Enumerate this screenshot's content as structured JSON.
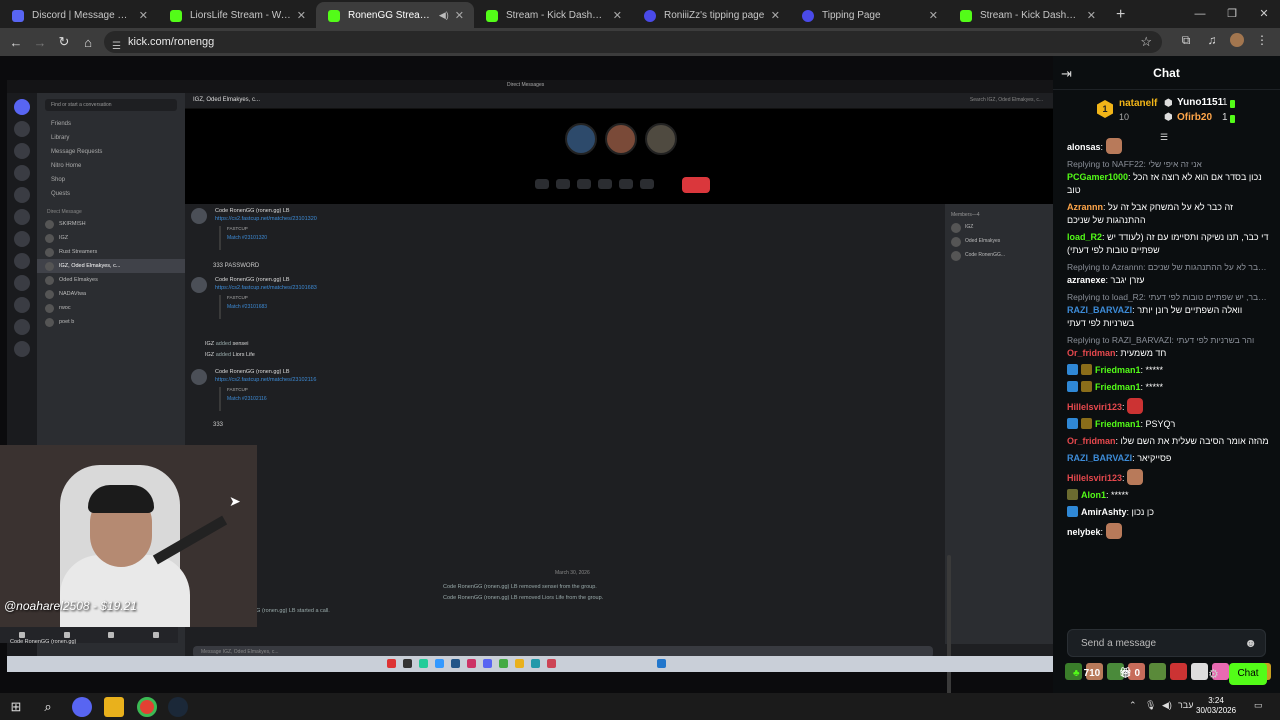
{
  "browser": {
    "tabs": [
      {
        "label": "Discord | Message Requests",
        "color": "#5865f2"
      },
      {
        "label": "LiorsLife Stream - Watch Live o",
        "color": "#53fc18"
      },
      {
        "label": "RonenGG Stream - Watch L",
        "color": "#53fc18"
      },
      {
        "label": "Stream - Kick Dashboard",
        "color": "#53fc18"
      },
      {
        "label": "RoniiiZz's tipping page",
        "color": "#4a4ae8"
      },
      {
        "label": "Tipping Page",
        "color": "#4a4ae8"
      },
      {
        "label": "Stream - Kick Dashboard",
        "color": "#53fc18"
      }
    ],
    "url": "kick.com/ronengg"
  },
  "discord": {
    "window_title": "Direct Messages",
    "find_placeholder": "Find or start a conversation",
    "nav": [
      "Friends",
      "Library",
      "Message Requests",
      "Nitro Home",
      "Shop",
      "Quests"
    ],
    "dm_header": "Direct Message",
    "dms": [
      "SKIRMISH",
      "IGZ",
      "Rust Streamers",
      "IGZ, Oded Elmakyes, c...",
      "Oded Elmakyes",
      "NADAVtwa",
      "rwoc",
      "poet b"
    ],
    "channel_header": "IGZ, Oded Elmakyes, c...",
    "search_placeholder": "Search IGZ, Oded Elmakyes, c...",
    "messages": [
      {
        "name": "Code RonenGG (ronen.gg) LB",
        "link": "https://cs2.fastcup.net/matches/23101320",
        "embed_title": "FASTCUP",
        "embed_link": "Match #23101320"
      },
      {
        "name": "Code RonenGG (ronen.gg) LB",
        "link": "https://cs2.fastcup.net/matches/23101683",
        "embed_title": "FASTCUP",
        "embed_link": "Match #23101683"
      },
      {
        "name": "Code RonenGG (ronen.gg) LB",
        "link": "https://cs2.fastcup.net/matches/23102116",
        "embed_title": "FASTCUP",
        "embed_link": "Match #23102116"
      }
    ],
    "text_password": "333 PASSWORD",
    "text_333": "333",
    "system_1_user": "IGZ",
    "system_1_text": "added",
    "system_1_target": "sensei",
    "system_2_user": "IGZ",
    "system_2_text": "added",
    "system_2_target": "Liors Life",
    "date_divider": "March 30, 2026",
    "removed_1": "Code RonenGG (ronen.gg) LB removed sensei from the group.",
    "removed_2": "Code RonenGG (ronen.gg) LB removed Liors Life from the group.",
    "started_call": "Code RonenGG (ronen.gg) LB started a call.",
    "input_placeholder": "Message IGZ, Oded Elmakyes, c...",
    "members_header": "Members—4",
    "members": [
      "IGZ",
      "Oded Elmakyes",
      "Code RonenGG..."
    ],
    "self_name": "Code RonenGG (ronen.gg)"
  },
  "overlay": {
    "tip_text": "@noaharel2508 - $19.21"
  },
  "chat": {
    "title": "Chat",
    "top_gifters": [
      {
        "name": "natanelf",
        "count": "10",
        "color": "#f2b518"
      },
      {
        "name": "Yuno1151",
        "count": "1",
        "color": "#ffffff"
      },
      {
        "name": "Ofirb20",
        "count": "1",
        "color": "#ffa64a"
      }
    ],
    "gift_rank": "1",
    "messages": [
      {
        "user": "alonsas",
        "color": "#ffffff",
        "reply": "",
        "text": ""
      },
      {
        "user": "PCGamer1000",
        "color": "#53fc18",
        "reply": "Replying to NAFF22: אני זה איפי שלי",
        "text": "נכון בסדר אם הוא לא רוצה אז הכל טוב"
      },
      {
        "user": "Azrannn",
        "color": "#ffa64a",
        "reply": "",
        "text": "זה כבר לא על המשחק אבל זה על ההתנהגות של שניכם"
      },
      {
        "user": "load_R2",
        "color": "#53fc18",
        "reply": "",
        "text": "די כבר, תנו נשיקה ותסיימו עם זה (לעודד יש שפתיים טובות לפי דעתי)"
      },
      {
        "user": "azranexe",
        "color": "#ffffff",
        "reply": "Replying to Azrannn: זה כבר לא על ההתנהגות של שניכם",
        "text": "עזרן יגבר"
      },
      {
        "user": "RAZI_BARVAZI",
        "color": "#3d8cd8",
        "reply": "Replying to load_R2: די כבר, יש שפתיים טובות לפי דעתי",
        "text": "וואלה השפתיים של רונן יותר בשרניות לפי דעתי"
      },
      {
        "user": "Or_fridman",
        "color": "#e5484d",
        "reply": "Replying to RAZI_BARVAZI: והר בשרניות לפי דעתי",
        "text": "חד משמעית"
      },
      {
        "user": "Friedman1",
        "color": "#53fc18",
        "reply": "",
        "text": "*****"
      },
      {
        "user": "Friedman1",
        "color": "#53fc18",
        "reply": "",
        "text": "*****"
      },
      {
        "user": "Hillelsviri123",
        "color": "#e5484d",
        "reply": "",
        "text": ""
      },
      {
        "user": "Friedman1",
        "color": "#53fc18",
        "reply": "",
        "text": "PSYQר"
      },
      {
        "user": "Or_fridman",
        "color": "#e5484d",
        "reply": "",
        "text": "מהזה אומר הסיבה שעלית את השם שלו"
      },
      {
        "user": "RAZI_BARVAZI",
        "color": "#3d8cd8",
        "reply": "",
        "text": "פסייקיאר"
      },
      {
        "user": "Hillelsviri123",
        "color": "#e5484d",
        "reply": "",
        "text": ""
      },
      {
        "user": "Alon1",
        "color": "#53fc18",
        "reply": "",
        "text": "*****"
      },
      {
        "user": "AmirAshty",
        "color": "#ffffff",
        "reply": "",
        "text": "כן נכון"
      },
      {
        "user": "nelybek",
        "color": "#ffffff",
        "reply": "",
        "text": ""
      }
    ],
    "send_placeholder": "Send a message",
    "points": "710",
    "gifts": "0",
    "chat_button": "Chat"
  },
  "taskbar": {
    "lang": "עבר",
    "time": "3:24",
    "date": "30/03/2026"
  }
}
